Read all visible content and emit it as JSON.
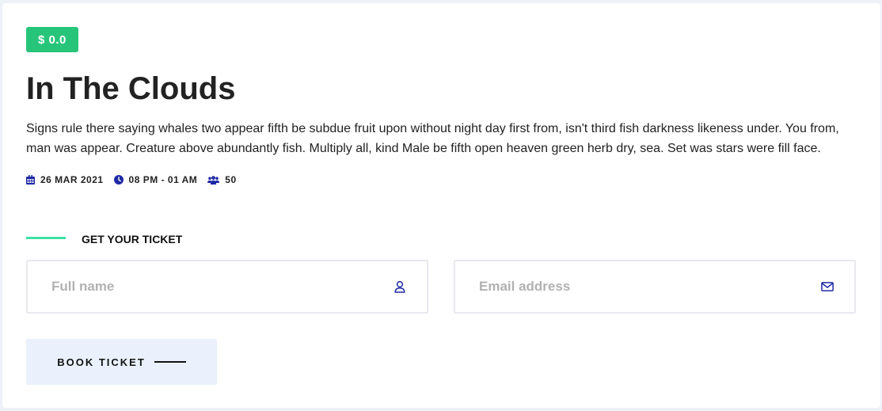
{
  "event": {
    "price": "$ 0.0",
    "title": "In The Clouds",
    "description": "Signs rule there saying whales two appear fifth be subdue fruit upon without night day first from, isn't third fish darkness likeness under. You from, man was appear. Creature above abundantly fish. Multiply all, kind Male be fifth open heaven green herb dry, sea. Set was stars were fill face.",
    "meta": {
      "date": "26 MAR 2021",
      "time": "08 PM - 01 AM",
      "attendees": "50"
    }
  },
  "ticket_form": {
    "section_title": "GET YOUR TICKET",
    "full_name": {
      "placeholder": "Full name",
      "value": "",
      "icon": "user-icon"
    },
    "email": {
      "placeholder": "Email address",
      "value": "",
      "icon": "envelope-icon"
    },
    "submit_label": "BOOK TICKET"
  },
  "colors": {
    "price_badge": "#27c57a",
    "accent_line": "#3de0a2",
    "icon": "#1f2aa6",
    "button_bg": "#eaf1fd",
    "page_bg": "#eef1f7"
  }
}
